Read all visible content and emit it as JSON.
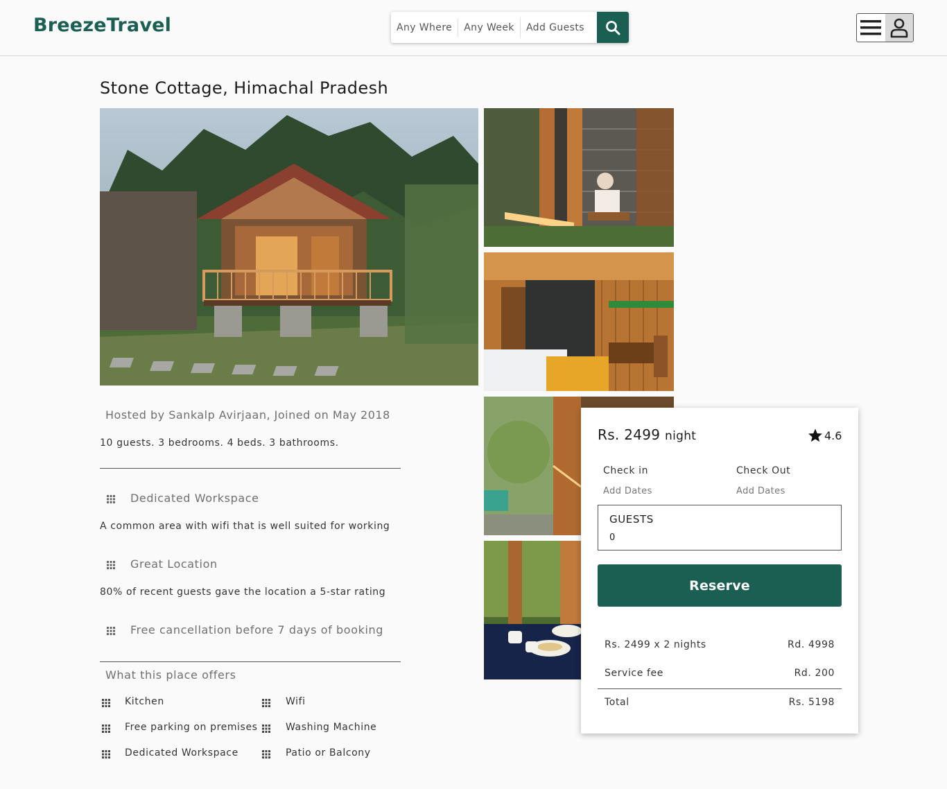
{
  "header": {
    "logo": "BreezeTravel",
    "search": {
      "where": "Any Where",
      "when": "Any Week",
      "guests": "Add Guests"
    }
  },
  "listing": {
    "title": "Stone Cottage, Himachal Pradesh",
    "host": "Hosted by Sankalp Avirjaan, Joined on May 2018",
    "counts": "10 guests. 3 bedrooms. 4 beds. 3 bathrooms."
  },
  "features": [
    {
      "title": "Dedicated Workspace",
      "desc": "A common area with wifi that is well suited for working"
    },
    {
      "title": "Great Location",
      "desc": "80% of recent guests gave the location a 5-star rating"
    },
    {
      "title": "Free cancellation before 7 days of booking",
      "desc": ""
    }
  ],
  "offers": {
    "title": "What this place offers",
    "items": [
      "Kitchen",
      "Wifi",
      "Free parking on premises",
      "Washing Machine",
      "Dedicated Workspace",
      "Patio or Balcony"
    ]
  },
  "booking": {
    "price": "Rs. 2499",
    "price_unit": "night",
    "rating": "4.6",
    "checkin_label": "Check in",
    "checkin_value": "Add Dates",
    "checkout_label": "Check Out",
    "checkout_value": "Add Dates",
    "guests_label": "GUESTS",
    "guests_value": "0",
    "reserve_label": "Reserve",
    "lines": [
      {
        "label": "Rs. 2499 x 2 nights",
        "value": "Rd. 4998"
      },
      {
        "label": "Service fee",
        "value": "Rd. 200"
      }
    ],
    "total_label": "Total",
    "total_value": "Rs. 5198"
  },
  "colors": {
    "brand": "#1a5f52",
    "background": "#fafafa"
  }
}
